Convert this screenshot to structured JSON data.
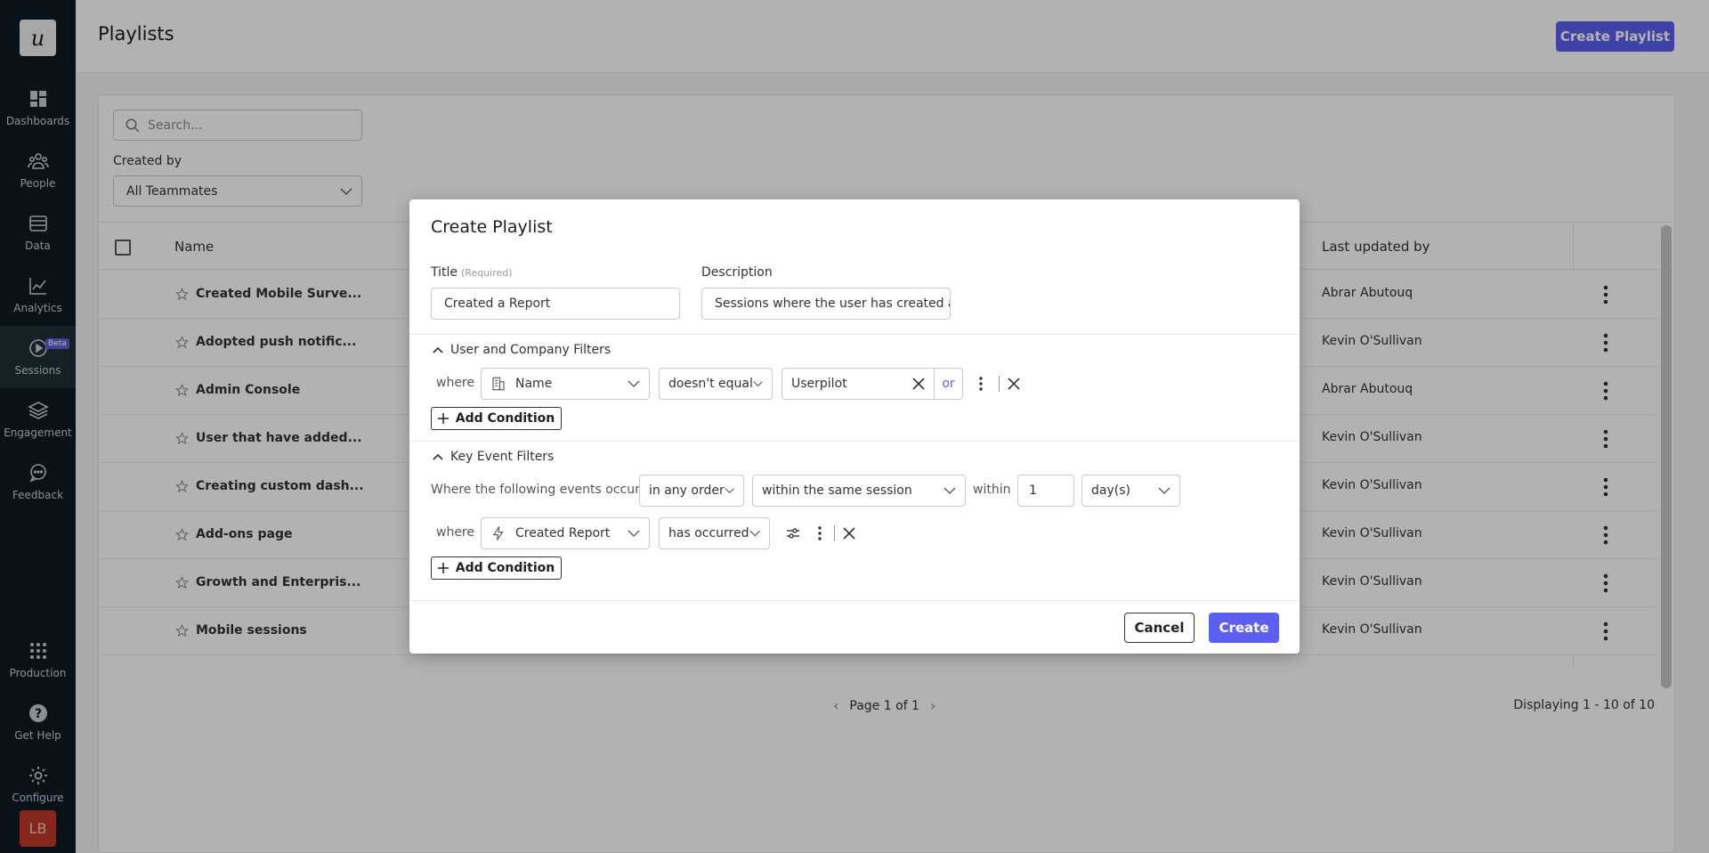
{
  "sidebar": {
    "logo": "u",
    "items": [
      {
        "label": "Dashboards",
        "icon": "dashboard-icon"
      },
      {
        "label": "People",
        "icon": "people-icon"
      },
      {
        "label": "Data",
        "icon": "data-icon"
      },
      {
        "label": "Analytics",
        "icon": "analytics-icon"
      },
      {
        "label": "Sessions",
        "icon": "play-circle-icon",
        "badge": "Beta",
        "active": true
      },
      {
        "label": "Engagement",
        "icon": "layers-icon"
      },
      {
        "label": "Feedback",
        "icon": "chat-bubble-icon"
      }
    ],
    "bottom_items": [
      {
        "label": "Production",
        "icon": "grid-icon"
      },
      {
        "label": "Get Help",
        "icon": "help-icon"
      },
      {
        "label": "Configure",
        "icon": "gear-icon"
      }
    ],
    "avatar": "LB"
  },
  "header": {
    "title": "Playlists",
    "create_button": "Create Playlist"
  },
  "filters": {
    "search_placeholder": "Search...",
    "created_by_label": "Created by",
    "created_by_value": "All Teammates"
  },
  "table": {
    "columns": {
      "name": "Name",
      "last_updated_by": "Last updated by"
    },
    "rows": [
      {
        "name": "Created Mobile Surve...",
        "updated_by": "Abrar Abutouq"
      },
      {
        "name": "Adopted push notific...",
        "updated_by": "Kevin O'Sullivan"
      },
      {
        "name": "Admin Console",
        "updated_by": "Abrar Abutouq"
      },
      {
        "name": "User that have added...",
        "updated_by": "Kevin O'Sullivan"
      },
      {
        "name": "Creating custom dash...",
        "updated_by": "Kevin O'Sullivan"
      },
      {
        "name": "Add-ons page",
        "updated_by": "Kevin O'Sullivan"
      },
      {
        "name": "Growth and Enterpris...",
        "updated_by": "Kevin O'Sullivan"
      },
      {
        "name": "Mobile sessions",
        "updated_by": "Kevin O'Sullivan"
      }
    ]
  },
  "pagination": {
    "page_text": "Page 1 of 1",
    "display_text": "Displaying 1 - 10 of 10"
  },
  "modal": {
    "title": "Create Playlist",
    "title_label": "Title",
    "title_required": "(Required)",
    "title_value": "Created a Report",
    "description_label": "Description",
    "description_value": "Sessions where the user has created a",
    "user_company_section": "User and Company Filters",
    "where": "where",
    "user_filter": {
      "property": "Name",
      "operator": "doesn't equal",
      "value": "Userpilot",
      "or": "or"
    },
    "add_condition": "Add Condition",
    "key_event_section": "Key Event Filters",
    "events_label": "Where the following events occur",
    "order_value": "in any order",
    "session_value": "within the same session",
    "within_label": "within",
    "within_number": "1",
    "within_unit": "day(s)",
    "event_filter": {
      "event": "Created Report",
      "condition": "has occurred"
    },
    "cancel": "Cancel",
    "create": "Create"
  },
  "colors": {
    "sidebar_bg": "#0e1b24",
    "accent": "#5d5fef",
    "avatar_bg": "#c0392b"
  }
}
